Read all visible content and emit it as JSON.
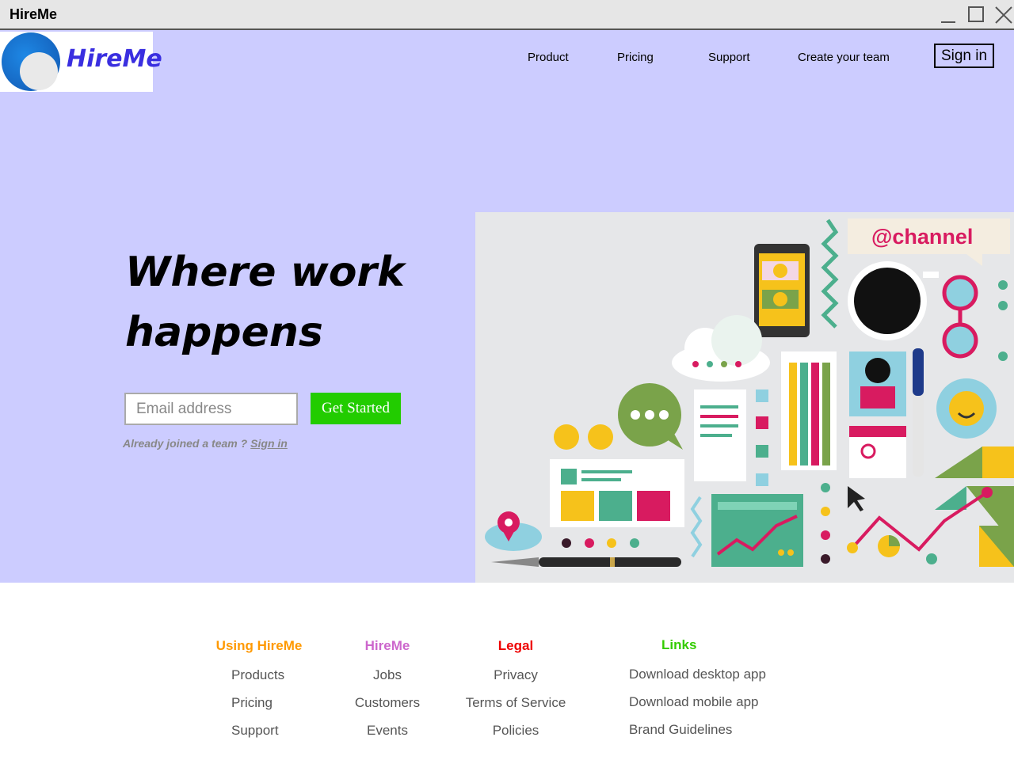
{
  "window": {
    "title": "HireMe"
  },
  "logo": {
    "text": "HireMe"
  },
  "nav": {
    "items": [
      "Product",
      "Pricing",
      "Support",
      "Create your team"
    ],
    "signin": "Sign in"
  },
  "hero": {
    "headline_line1": "Where work",
    "headline_line2": "happens",
    "email_placeholder": "Email address",
    "cta": "Get Started",
    "already_text": "Already joined a team ?",
    "already_link": "Sign in"
  },
  "illustration": {
    "channel_tag": "@channel"
  },
  "footer": {
    "columns": [
      {
        "heading": "Using HireMe",
        "color": "#ff9900",
        "items": [
          "Products",
          "Pricing",
          "Support"
        ]
      },
      {
        "heading": "HireMe",
        "color": "#cc66cc",
        "items": [
          "Jobs",
          "Customers",
          "Events"
        ]
      },
      {
        "heading": "Legal",
        "color": "#ee0000",
        "items": [
          "Privacy",
          "Terms of Service",
          "Policies"
        ]
      },
      {
        "heading": "Links",
        "color": "#33cc00",
        "items": [
          "Download desktop app",
          "Download mobile app",
          "Brand Guidelines"
        ]
      }
    ]
  }
}
